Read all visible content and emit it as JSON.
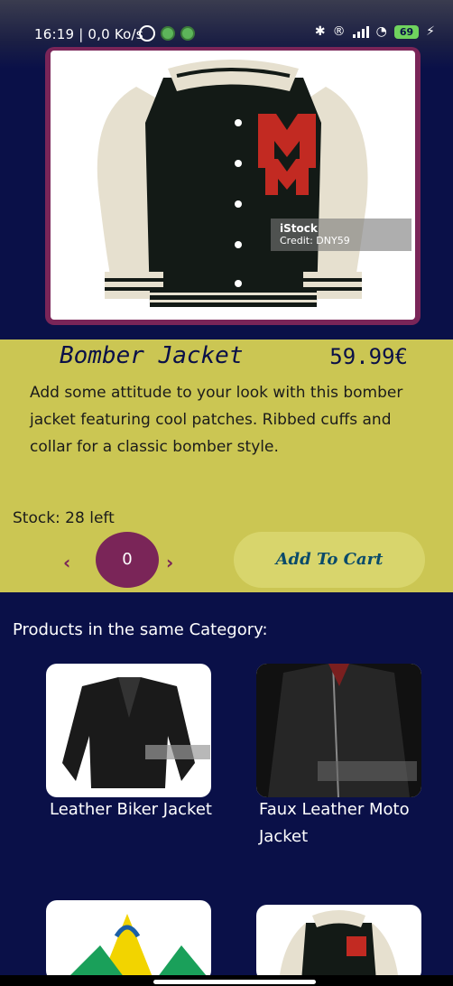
{
  "status_bar": {
    "time_network": "16:19 | 0,0 Ko/s",
    "battery": "69"
  },
  "product": {
    "name": "Bomber Jacket",
    "price": "59.99€",
    "description": "Add some attitude to your look with this bomber jacket featuring cool patches. Ribbed cuffs and collar for a classic bomber style.",
    "stock": "Stock: 28 left",
    "quantity": "0",
    "image_watermark_title": "iStock",
    "image_watermark_credit": "Credit: DNY59"
  },
  "actions": {
    "decrement": "‹",
    "increment": "›",
    "add_to_cart": "Add To Cart"
  },
  "related": {
    "heading": "Products in the same Category:",
    "items": [
      {
        "name": "Leather Biker Jacket"
      },
      {
        "name": "Faux Leather Moto Jacket"
      }
    ]
  },
  "colors": {
    "background": "#0a1048",
    "panel": "#cbc653",
    "accent": "#7a2558"
  }
}
